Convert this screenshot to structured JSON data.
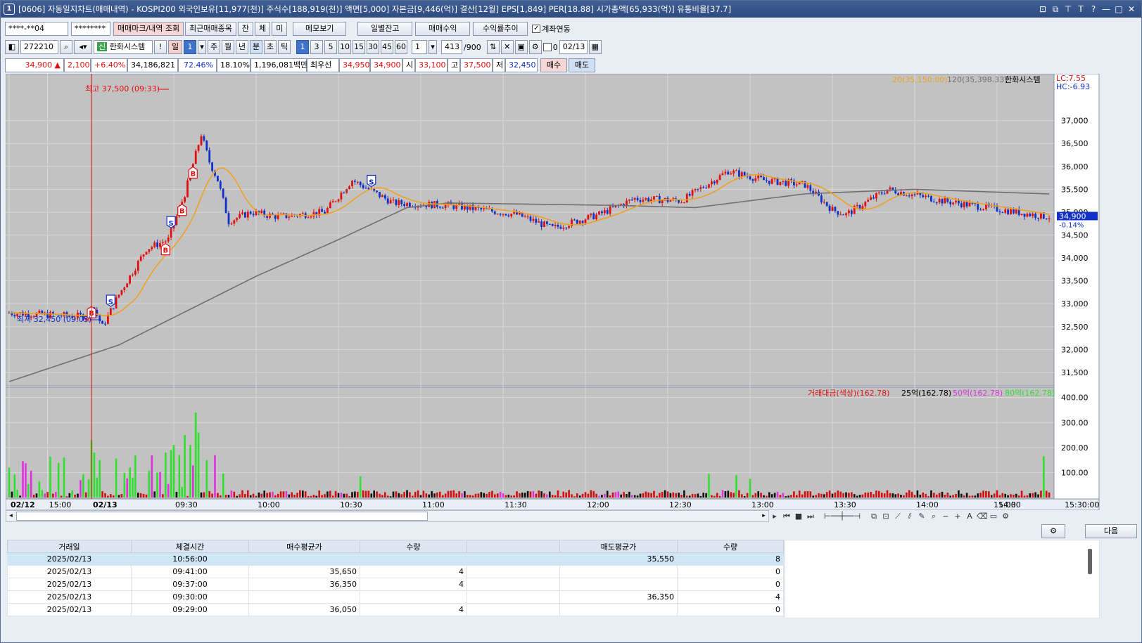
{
  "window": {
    "icon": "1",
    "title": "[0606] 자동일지차트(매매내역) - KOSPI200 외국인보유[11,977(천)] 주식수[188,919(천)] 액면[5,000] 자본금[9,446(억)] 결산[12월] EPS[1,849] PER[18.88] 시가총액[65,933(억)] 유통비율[37.7]",
    "title_buttons": [
      "⊡",
      "⧉",
      "⊤",
      "T",
      "?",
      "—",
      "□",
      "✕"
    ]
  },
  "toolbar1": {
    "account": "****-**04",
    "password": "********",
    "btn_mark_history": "매매마크/내역 조회",
    "btn_recent_items": "최근매매종목",
    "btn_jan": "잔",
    "btn_che": "체",
    "btn_mi": "미",
    "btn_memo": "메모보기",
    "btn_daily_balance": "일별잔고",
    "btn_trade_profit": "매매수익",
    "btn_return_trend": "수익률추이",
    "account_link_label": "계좌연동",
    "account_link_checked": "✓"
  },
  "toolbar2": {
    "code": "272210",
    "stock_name": "한화시스템",
    "stock_badge": "신",
    "info": "!",
    "period_day": "일",
    "period_num": "1",
    "periods": [
      "주",
      "월",
      "년",
      "분",
      "초",
      "틱"
    ],
    "minutes": [
      "1",
      "3",
      "5",
      "10",
      "15",
      "30",
      "45",
      "60"
    ],
    "multiplier": "1",
    "count": "413",
    "count_max": "/900",
    "date_prefix": "0",
    "date": "02/13"
  },
  "pricebar": {
    "price": "34,900",
    "up_arrow": "▲",
    "change": "2,100",
    "change_pct": "+6.40%",
    "volume": "34,186,821",
    "ratio1": "72.46%",
    "ratio2": "18.10%",
    "amount": "1,196,081백만",
    "best_label": "최우선",
    "best_ask": "34,950",
    "best_bid": "34,900",
    "open_label": "시",
    "open": "33,100",
    "high_label": "고",
    "high": "37,500",
    "low_label": "저",
    "low": "32,450",
    "buy_btn": "매수",
    "sell_btn": "매도"
  },
  "chart_legend": {
    "ma20": "20(35,150.00)",
    "ma120": "120(35,398.33)",
    "name": "한화시스템",
    "lc": "LC:7.55",
    "hc": "HC:-6.93",
    "cur_price": "34,900",
    "cur_pct": "-0.14%",
    "high_note": "최고 37,500 (09:33)",
    "low_note": "최저 32,450 (09:05)",
    "vol_title": "거래대금(색상)(162.78)",
    "vol_25": "25억(162.78)",
    "vol_50": "50억(162.78)",
    "vol_80": "80억(162.78)"
  },
  "chart_data": {
    "type": "candlestick",
    "title": "",
    "price_axis": [
      "37,000",
      "36,500",
      "36,000",
      "35,500",
      "35,000",
      "34,500",
      "34,000",
      "33,500",
      "33,000",
      "32,500",
      "32,000",
      "31,500"
    ],
    "volume_axis": [
      "400.00",
      "300.00",
      "200.00",
      "100.00"
    ],
    "time_axis": [
      "02/12",
      "15:00",
      "02/13",
      "09:30",
      "10:00",
      "10:30",
      "11:00",
      "11:30",
      "12:00",
      "12:30",
      "13:00",
      "13:30",
      "14:00",
      "14:30",
      "15:00",
      "15:30:00"
    ],
    "ylim": [
      31300,
      37900
    ],
    "anchors": [
      {
        "i": 0,
        "p": 32800
      },
      {
        "i": 28,
        "p": 32720
      },
      {
        "i": 30,
        "p": 33000
      },
      {
        "i": 34,
        "p": 32500
      },
      {
        "i": 40,
        "p": 33200
      },
      {
        "i": 50,
        "p": 34200
      },
      {
        "i": 58,
        "p": 34400
      },
      {
        "i": 64,
        "p": 35400
      },
      {
        "i": 70,
        "p": 36700
      },
      {
        "i": 73,
        "p": 36100
      },
      {
        "i": 76,
        "p": 35700
      },
      {
        "i": 80,
        "p": 34800
      },
      {
        "i": 88,
        "p": 35000
      },
      {
        "i": 98,
        "p": 34900
      },
      {
        "i": 115,
        "p": 35000
      },
      {
        "i": 125,
        "p": 35700
      },
      {
        "i": 140,
        "p": 35200
      },
      {
        "i": 160,
        "p": 35150
      },
      {
        "i": 185,
        "p": 34950
      },
      {
        "i": 198,
        "p": 34650
      },
      {
        "i": 215,
        "p": 34950
      },
      {
        "i": 228,
        "p": 35300
      },
      {
        "i": 245,
        "p": 35250
      },
      {
        "i": 262,
        "p": 35900
      },
      {
        "i": 275,
        "p": 35700
      },
      {
        "i": 290,
        "p": 35600
      },
      {
        "i": 300,
        "p": 35050
      },
      {
        "i": 305,
        "p": 34950
      },
      {
        "i": 320,
        "p": 35500
      },
      {
        "i": 340,
        "p": 35250
      },
      {
        "i": 362,
        "p": 35050
      },
      {
        "i": 378,
        "p": 34900
      }
    ],
    "ma120_anchors": [
      {
        "i": 0,
        "p": 31300
      },
      {
        "i": 40,
        "p": 32100
      },
      {
        "i": 60,
        "p": 32700
      },
      {
        "i": 90,
        "p": 33600
      },
      {
        "i": 120,
        "p": 34400
      },
      {
        "i": 145,
        "p": 35100
      },
      {
        "i": 160,
        "p": 35200
      },
      {
        "i": 220,
        "p": 35150
      },
      {
        "i": 250,
        "p": 35100
      },
      {
        "i": 290,
        "p": 35400
      },
      {
        "i": 330,
        "p": 35500
      },
      {
        "i": 378,
        "p": 35400
      }
    ],
    "volume_spikes": [
      {
        "i": 0,
        "v": 120,
        "c": "g"
      },
      {
        "i": 30,
        "v": 230,
        "c": "g"
      },
      {
        "i": 31,
        "v": 180,
        "c": "g"
      },
      {
        "i": 33,
        "v": 150,
        "c": "g"
      },
      {
        "i": 44,
        "v": 120,
        "c": "g"
      },
      {
        "i": 57,
        "v": 180,
        "c": "g"
      },
      {
        "i": 59,
        "v": 190,
        "c": "g"
      },
      {
        "i": 60,
        "v": 210,
        "c": "g"
      },
      {
        "i": 62,
        "v": 170,
        "c": "g"
      },
      {
        "i": 64,
        "v": 250,
        "c": "g"
      },
      {
        "i": 66,
        "v": 210,
        "c": "g"
      },
      {
        "i": 68,
        "v": 340,
        "c": "g"
      },
      {
        "i": 69,
        "v": 260,
        "c": "g"
      },
      {
        "i": 72,
        "v": 150,
        "c": "g"
      },
      {
        "i": 128,
        "v": 85,
        "c": "g"
      },
      {
        "i": 255,
        "v": 95,
        "c": "g"
      },
      {
        "i": 265,
        "v": 90,
        "c": "g"
      },
      {
        "i": 270,
        "v": 75,
        "c": "g"
      },
      {
        "i": 377,
        "v": 165,
        "c": "g"
      }
    ]
  },
  "trade_marks": [
    {
      "i": 30,
      "type": "B"
    },
    {
      "i": 37,
      "type": "S"
    },
    {
      "i": 57,
      "type": "B"
    },
    {
      "i": 59,
      "type": "S"
    },
    {
      "i": 63,
      "type": "B"
    },
    {
      "i": 67,
      "type": "B"
    },
    {
      "i": 132,
      "type": "S"
    }
  ],
  "scroll": {
    "next_label": "다음"
  },
  "grid": {
    "headers": [
      "거래일",
      "체결시간",
      "매수평균가",
      "수량",
      "",
      "매도평균가",
      "수량"
    ],
    "rows": [
      [
        "2025/02/13",
        "10:56:00",
        "",
        "",
        "",
        "35,550",
        "8"
      ],
      [
        "2025/02/13",
        "09:41:00",
        "35,650",
        "4",
        "",
        "",
        "0"
      ],
      [
        "2025/02/13",
        "09:37:00",
        "36,350",
        "4",
        "",
        "",
        "0"
      ],
      [
        "2025/02/13",
        "09:30:00",
        "",
        "",
        "",
        "36,350",
        "4"
      ],
      [
        "2025/02/13",
        "09:29:00",
        "36,050",
        "4",
        "",
        "",
        "0"
      ]
    ]
  },
  "colors": {
    "up": "#e01010",
    "down": "#1030c8",
    "ma20": "#f0a020",
    "ma120": "#707070",
    "vol_green": "#30e030",
    "vol_magenta": "#e030e0"
  }
}
